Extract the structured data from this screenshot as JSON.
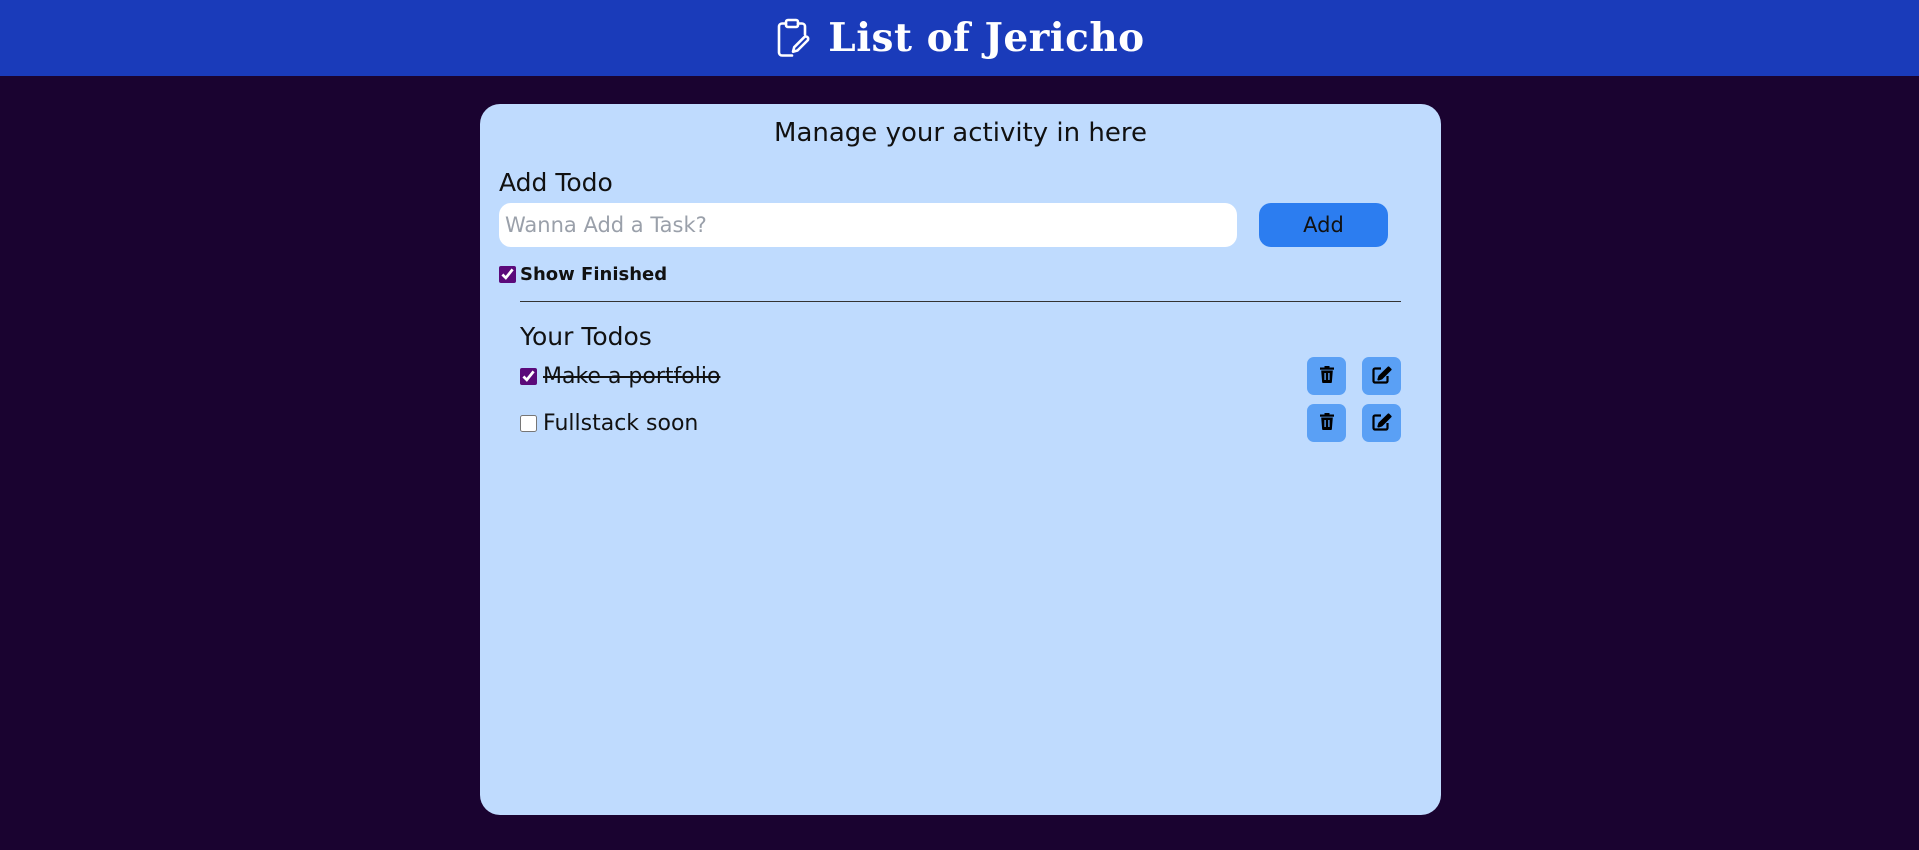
{
  "header": {
    "title": "List of Jericho",
    "icon": "clipboard-edit-icon"
  },
  "card": {
    "title": "Manage your activity in here",
    "add_heading": "Add Todo",
    "input": {
      "placeholder": "Wanna Add a Task?",
      "value": ""
    },
    "add_label": "Add",
    "show_finished": {
      "label": "Show Finished",
      "checked": true
    },
    "todos_heading": "Your Todos",
    "todos": [
      {
        "text": "Make a portfolio",
        "done": true
      },
      {
        "text": "Fullstack soon",
        "done": false
      }
    ]
  },
  "colors": {
    "header_bg": "#1a3bba",
    "page_bg": "#1a0330",
    "card_bg": "#bfdbfe",
    "add_button": "#2c7df0",
    "icon_button": "#5aa0f5",
    "checkbox_accent": "#5b0a7a"
  },
  "icons": {
    "delete": "trash-icon",
    "edit": "edit-icon"
  }
}
